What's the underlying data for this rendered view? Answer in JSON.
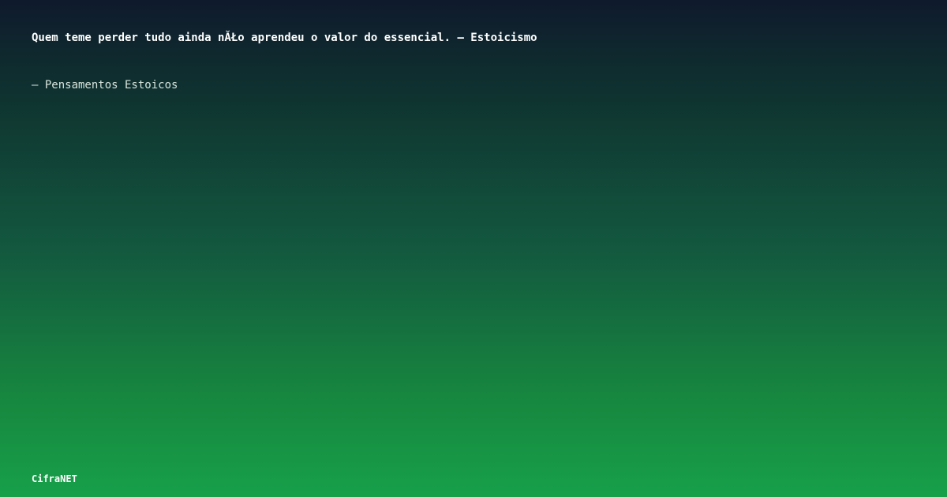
{
  "quote": {
    "text": "Quem teme perder tudo ainda nĂŁo aprendeu o valor do essencial. – Estoicismo"
  },
  "source": {
    "text": "– Pensamentos Estoicos"
  },
  "brand": {
    "name": "CifraNET"
  },
  "colors": {
    "background_top": "#0f1a2c",
    "background_bottom": "#17a04a",
    "text_primary": "#ffffff",
    "text_secondary": "#d8e4dc"
  }
}
